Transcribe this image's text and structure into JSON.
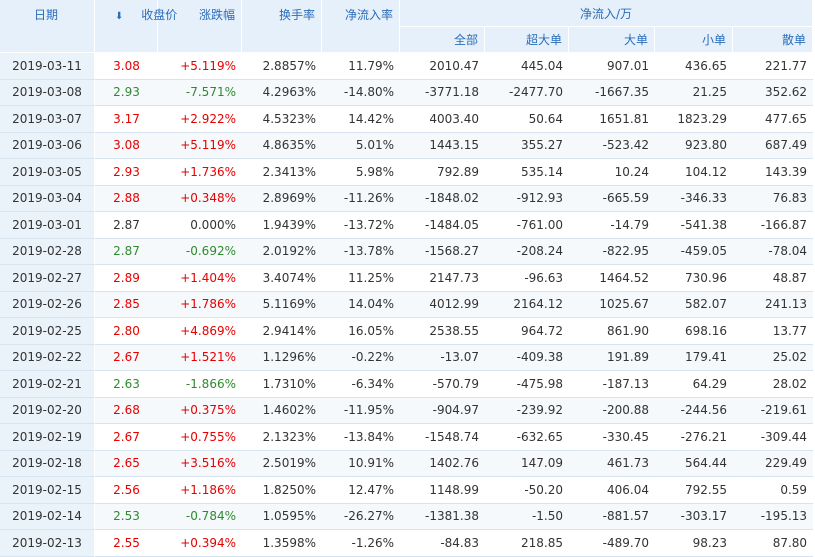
{
  "header": {
    "date": "日期",
    "close": "收盘价",
    "change": "涨跌幅",
    "turnover": "换手率",
    "net_rate": "净流入率",
    "net_flow": "净流入/万",
    "all": "全部",
    "xlarge": "超大单",
    "large": "大单",
    "small": "小单",
    "retail": "散单"
  },
  "colors": {
    "up": "#e60000",
    "down": "#2f8a2f",
    "header_bg": "#e6f0fb",
    "header_text": "#2b6cb9"
  },
  "rows": [
    {
      "date": "2019-03-11",
      "close": "3.08",
      "change": "+5.119%",
      "turnover": "2.8857%",
      "rate": "11.79%",
      "all": "2010.47",
      "xl": "445.04",
      "l": "907.01",
      "m": "436.65",
      "s": "221.77",
      "dir": "up"
    },
    {
      "date": "2019-03-08",
      "close": "2.93",
      "change": "-7.571%",
      "turnover": "4.2963%",
      "rate": "-14.80%",
      "all": "-3771.18",
      "xl": "-2477.70",
      "l": "-1667.35",
      "m": "21.25",
      "s": "352.62",
      "dir": "down"
    },
    {
      "date": "2019-03-07",
      "close": "3.17",
      "change": "+2.922%",
      "turnover": "4.5323%",
      "rate": "14.42%",
      "all": "4003.40",
      "xl": "50.64",
      "l": "1651.81",
      "m": "1823.29",
      "s": "477.65",
      "dir": "up"
    },
    {
      "date": "2019-03-06",
      "close": "3.08",
      "change": "+5.119%",
      "turnover": "4.8635%",
      "rate": "5.01%",
      "all": "1443.15",
      "xl": "355.27",
      "l": "-523.42",
      "m": "923.80",
      "s": "687.49",
      "dir": "up"
    },
    {
      "date": "2019-03-05",
      "close": "2.93",
      "change": "+1.736%",
      "turnover": "2.3413%",
      "rate": "5.98%",
      "all": "792.89",
      "xl": "535.14",
      "l": "10.24",
      "m": "104.12",
      "s": "143.39",
      "dir": "up"
    },
    {
      "date": "2019-03-04",
      "close": "2.88",
      "change": "+0.348%",
      "turnover": "2.8969%",
      "rate": "-11.26%",
      "all": "-1848.02",
      "xl": "-912.93",
      "l": "-665.59",
      "m": "-346.33",
      "s": "76.83",
      "dir": "up"
    },
    {
      "date": "2019-03-01",
      "close": "2.87",
      "change": "0.000%",
      "turnover": "1.9439%",
      "rate": "-13.72%",
      "all": "-1484.05",
      "xl": "-761.00",
      "l": "-14.79",
      "m": "-541.38",
      "s": "-166.87",
      "dir": "flat"
    },
    {
      "date": "2019-02-28",
      "close": "2.87",
      "change": "-0.692%",
      "turnover": "2.0192%",
      "rate": "-13.78%",
      "all": "-1568.27",
      "xl": "-208.24",
      "l": "-822.95",
      "m": "-459.05",
      "s": "-78.04",
      "dir": "down"
    },
    {
      "date": "2019-02-27",
      "close": "2.89",
      "change": "+1.404%",
      "turnover": "3.4074%",
      "rate": "11.25%",
      "all": "2147.73",
      "xl": "-96.63",
      "l": "1464.52",
      "m": "730.96",
      "s": "48.87",
      "dir": "up"
    },
    {
      "date": "2019-02-26",
      "close": "2.85",
      "change": "+1.786%",
      "turnover": "5.1169%",
      "rate": "14.04%",
      "all": "4012.99",
      "xl": "2164.12",
      "l": "1025.67",
      "m": "582.07",
      "s": "241.13",
      "dir": "up"
    },
    {
      "date": "2019-02-25",
      "close": "2.80",
      "change": "+4.869%",
      "turnover": "2.9414%",
      "rate": "16.05%",
      "all": "2538.55",
      "xl": "964.72",
      "l": "861.90",
      "m": "698.16",
      "s": "13.77",
      "dir": "up"
    },
    {
      "date": "2019-02-22",
      "close": "2.67",
      "change": "+1.521%",
      "turnover": "1.1296%",
      "rate": "-0.22%",
      "all": "-13.07",
      "xl": "-409.38",
      "l": "191.89",
      "m": "179.41",
      "s": "25.02",
      "dir": "up"
    },
    {
      "date": "2019-02-21",
      "close": "2.63",
      "change": "-1.866%",
      "turnover": "1.7310%",
      "rate": "-6.34%",
      "all": "-570.79",
      "xl": "-475.98",
      "l": "-187.13",
      "m": "64.29",
      "s": "28.02",
      "dir": "down"
    },
    {
      "date": "2019-02-20",
      "close": "2.68",
      "change": "+0.375%",
      "turnover": "1.4602%",
      "rate": "-11.95%",
      "all": "-904.97",
      "xl": "-239.92",
      "l": "-200.88",
      "m": "-244.56",
      "s": "-219.61",
      "dir": "up"
    },
    {
      "date": "2019-02-19",
      "close": "2.67",
      "change": "+0.755%",
      "turnover": "2.1323%",
      "rate": "-13.84%",
      "all": "-1548.74",
      "xl": "-632.65",
      "l": "-330.45",
      "m": "-276.21",
      "s": "-309.44",
      "dir": "up"
    },
    {
      "date": "2019-02-18",
      "close": "2.65",
      "change": "+3.516%",
      "turnover": "2.5019%",
      "rate": "10.91%",
      "all": "1402.76",
      "xl": "147.09",
      "l": "461.73",
      "m": "564.44",
      "s": "229.49",
      "dir": "up"
    },
    {
      "date": "2019-02-15",
      "close": "2.56",
      "change": "+1.186%",
      "turnover": "1.8250%",
      "rate": "12.47%",
      "all": "1148.99",
      "xl": "-50.20",
      "l": "406.04",
      "m": "792.55",
      "s": "0.59",
      "dir": "up"
    },
    {
      "date": "2019-02-14",
      "close": "2.53",
      "change": "-0.784%",
      "turnover": "1.0595%",
      "rate": "-26.27%",
      "all": "-1381.38",
      "xl": "-1.50",
      "l": "-881.57",
      "m": "-303.17",
      "s": "-195.13",
      "dir": "down"
    },
    {
      "date": "2019-02-13",
      "close": "2.55",
      "change": "+0.394%",
      "turnover": "1.3598%",
      "rate": "-1.26%",
      "all": "-84.83",
      "xl": "218.85",
      "l": "-489.70",
      "m": "98.23",
      "s": "87.80",
      "dir": "up"
    }
  ]
}
